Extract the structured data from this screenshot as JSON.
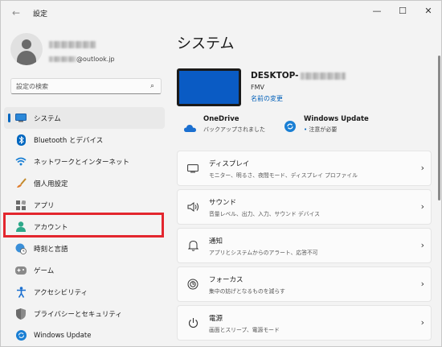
{
  "window": {
    "title": "設定",
    "controls": {
      "minimize": "—",
      "maximize": "☐",
      "close": "✕"
    }
  },
  "profile": {
    "email_suffix": "@outlook.jp"
  },
  "search": {
    "placeholder": "設定の検索"
  },
  "nav": {
    "items": [
      {
        "label": "システム",
        "icon": "monitor-icon"
      },
      {
        "label": "Bluetooth とデバイス",
        "icon": "bluetooth-icon"
      },
      {
        "label": "ネットワークとインターネット",
        "icon": "wifi-icon"
      },
      {
        "label": "個人用設定",
        "icon": "brush-icon"
      },
      {
        "label": "アプリ",
        "icon": "apps-icon"
      },
      {
        "label": "アカウント",
        "icon": "account-icon"
      },
      {
        "label": "時刻と言語",
        "icon": "globe-clock-icon"
      },
      {
        "label": "ゲーム",
        "icon": "gamepad-icon"
      },
      {
        "label": "アクセシビリティ",
        "icon": "accessibility-icon"
      },
      {
        "label": "プライバシーとセキュリティ",
        "icon": "shield-icon"
      },
      {
        "label": "Windows Update",
        "icon": "update-icon"
      }
    ]
  },
  "main": {
    "title": "システム",
    "device": {
      "name_prefix": "DESKTOP-",
      "model": "FMV",
      "rename_link": "名前の変更"
    },
    "status": [
      {
        "title": "OneDrive",
        "sub": "バックアップされました",
        "icon": "cloud-icon"
      },
      {
        "title": "Windows Update",
        "sub_dot": "•",
        "sub": " 注意が必要",
        "icon": "sync-icon"
      }
    ],
    "settings": [
      {
        "title": "ディスプレイ",
        "sub": "モニター、明るさ、夜間モード、ディスプレイ プロファイル",
        "icon": "display-icon"
      },
      {
        "title": "サウンド",
        "sub": "音量レベル、出力、入力、サウンド デバイス",
        "icon": "speaker-icon"
      },
      {
        "title": "通知",
        "sub": "アプリとシステムからのアラート、応答不可",
        "icon": "bell-icon"
      },
      {
        "title": "フォーカス",
        "sub": "集中の妨げとなるものを減らす",
        "icon": "focus-icon"
      },
      {
        "title": "電源",
        "sub": "画面とスリープ、電源モード",
        "icon": "power-icon"
      }
    ],
    "chevron": "›"
  },
  "colors": {
    "accent": "#0067c0",
    "highlight": "#e3262e",
    "device": "#0a5bc4"
  }
}
